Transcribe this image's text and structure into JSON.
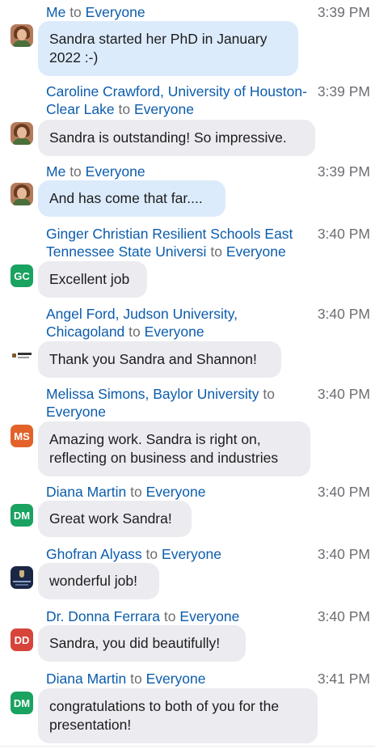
{
  "connector": "to",
  "messages": [
    {
      "sender": "Me",
      "target": "Everyone",
      "time": "3:39 PM",
      "avatar": {
        "kind": "photo"
      },
      "mine": true,
      "text": [
        "Sandra started her PhD in January",
        "2022 :-)"
      ]
    },
    {
      "sender": "Caroline Crawford, University of Houston-Clear Lake",
      "target": "Everyone",
      "time": "3:39 PM",
      "avatar": {
        "kind": "photo"
      },
      "mine": false,
      "text": [
        "Sandra is outstanding! So impressive."
      ]
    },
    {
      "sender": "Me",
      "target": "Everyone",
      "time": "3:39 PM",
      "avatar": {
        "kind": "photo"
      },
      "mine": true,
      "text": [
        "And has come that far...."
      ]
    },
    {
      "sender": "Ginger Christian Resilient Schools East Tennessee State Universi",
      "target": "Everyone",
      "time": "3:40 PM",
      "avatar": {
        "kind": "initials",
        "initials": "GC",
        "color": "#1aa260"
      },
      "mine": false,
      "text": [
        "Excellent job"
      ]
    },
    {
      "sender": "Angel Ford, Judson University, Chicagoland",
      "target": "Everyone",
      "time": "3:40 PM",
      "avatar": {
        "kind": "logo"
      },
      "mine": false,
      "text": [
        "Thank you Sandra and Shannon!"
      ]
    },
    {
      "sender": "Melissa Simons, Baylor University",
      "target": "Everyone",
      "time": "3:40 PM",
      "avatar": {
        "kind": "initials",
        "initials": "MS",
        "color": "#e2622a"
      },
      "mine": false,
      "text": [
        "Amazing work. Sandra is right on,",
        "reflecting on business and industries"
      ]
    },
    {
      "sender": "Diana Martin",
      "target": "Everyone",
      "time": "3:40 PM",
      "avatar": {
        "kind": "initials",
        "initials": "DM",
        "color": "#1aa260"
      },
      "mine": false,
      "text": [
        "Great work Sandra!"
      ]
    },
    {
      "sender": "Ghofran Alyass",
      "target": "Everyone",
      "time": "3:40 PM",
      "avatar": {
        "kind": "image-navy"
      },
      "mine": false,
      "text": [
        "wonderful job!"
      ]
    },
    {
      "sender": "Dr. Donna Ferrara",
      "target": "Everyone",
      "time": "3:40 PM",
      "avatar": {
        "kind": "initials",
        "initials": "DD",
        "color": "#d7443a"
      },
      "mine": false,
      "text": [
        "Sandra, you did beautifully!"
      ]
    },
    {
      "sender": "Diana Martin",
      "target": "Everyone",
      "time": "3:41 PM",
      "avatar": {
        "kind": "initials",
        "initials": "DM",
        "color": "#1aa260"
      },
      "mine": false,
      "text": [
        "congratulations to both of you for the",
        "presentation!"
      ]
    }
  ]
}
